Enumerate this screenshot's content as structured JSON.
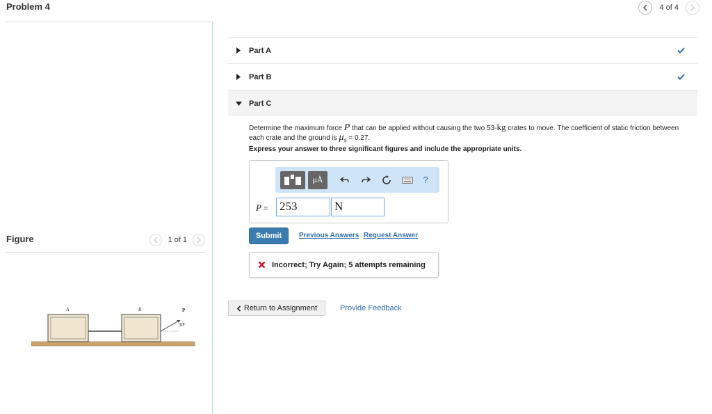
{
  "header": {
    "title": "Problem 4",
    "pager": "4 of 4"
  },
  "parts": [
    {
      "label": "Part A",
      "completed": true
    },
    {
      "label": "Part B",
      "completed": true
    },
    {
      "label": "Part C",
      "completed": false,
      "expanded": true
    }
  ],
  "question": {
    "text_before": "Determine the maximum force ",
    "var_P": "P",
    "text_mid": " that can be applied without causing the two 53-",
    "unit_kg": "kg",
    "text_after": " crates to move. The coefficient of static friction between each crate and the ground is ",
    "var_mu": "μ",
    "mu_sub": "s",
    "mu_value": " = 0.27.",
    "instruction": "Express your answer to three significant figures and include the appropriate units."
  },
  "answer": {
    "label_var": "P",
    "label_eq": " =",
    "value": "253",
    "unit": "N",
    "toolbar": {
      "units_label": "μÅ",
      "help_label": "?"
    }
  },
  "actions": {
    "submit": "Submit",
    "previous_answers": "Previous Answers",
    "request_answer": "Request Answer"
  },
  "feedback": {
    "message": "Incorrect; Try Again; 5 attempts remaining"
  },
  "footer": {
    "return": "Return to Assignment",
    "provide_feedback": "Provide Feedback"
  },
  "figure": {
    "title": "Figure",
    "pager": "1 of 1",
    "label_a": "A",
    "label_b": "B",
    "label_p": "P",
    "angle": "30°"
  },
  "colors": {
    "accent": "#3a7bb0",
    "link": "#2f6da8",
    "success": "#2f6da8",
    "error": "#c8102e",
    "toolbar_bg": "#cfe4f7"
  }
}
